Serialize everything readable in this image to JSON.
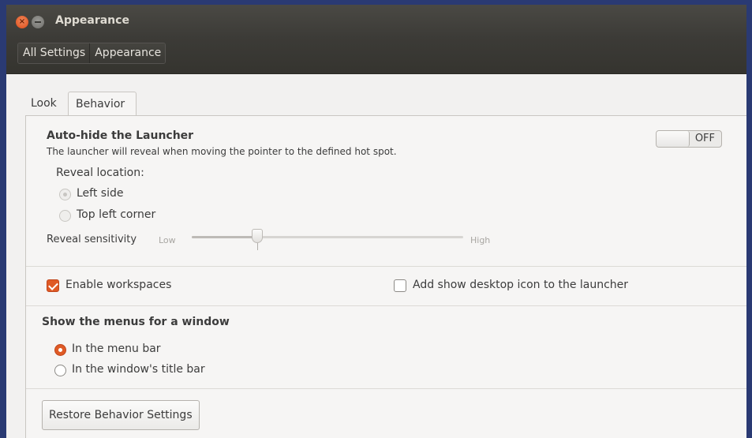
{
  "window": {
    "title": "Appearance",
    "close_glyph": "×"
  },
  "breadcrumb": {
    "items": [
      "All Settings",
      "Appearance"
    ]
  },
  "tabs": [
    {
      "label": "Look",
      "selected": false
    },
    {
      "label": "Behavior",
      "selected": true
    }
  ],
  "autohide": {
    "title": "Auto-hide the Launcher",
    "description": "The launcher will reveal when moving the pointer to the defined hot spot.",
    "toggle_state": "OFF",
    "reveal_location_label": "Reveal location:",
    "options": [
      {
        "label": "Left side",
        "selected": true
      },
      {
        "label": "Top left corner",
        "selected": false
      }
    ],
    "sensitivity_label": "Reveal sensitivity",
    "sensitivity_low": "Low",
    "sensitivity_high": "High",
    "sensitivity_value": 0.24
  },
  "workspaces": {
    "enable_label": "Enable workspaces",
    "enable_checked": true,
    "desktop_icon_label": "Add show desktop icon to the launcher",
    "desktop_icon_checked": false
  },
  "menus": {
    "title": "Show the menus for a window",
    "options": [
      {
        "label": "In the menu bar",
        "selected": true
      },
      {
        "label": "In the window's title bar",
        "selected": false
      }
    ]
  },
  "restore_button": "Restore Behavior Settings",
  "colors": {
    "accent": "#df5a25",
    "titlebar": "#3c3b37",
    "background": "#f2f1f0",
    "desktop": "#2a3a73"
  }
}
